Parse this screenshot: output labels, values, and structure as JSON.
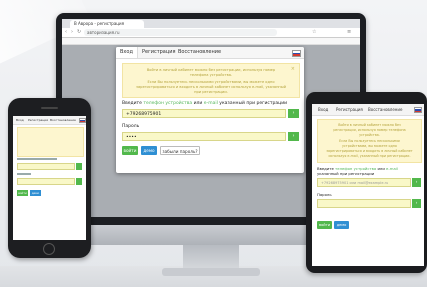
{
  "browser": {
    "tab_title": "В Аврора - регистрация",
    "url": "авторизация.ru"
  },
  "modal": {
    "tabs": [
      "Вход",
      "Регистрация",
      "Восстановление"
    ],
    "alert_lines": [
      "Войти в личный кабинет можно без регистрации, используя номер",
      "телефона устройства.",
      "Если Вы пользуетесь несколькими устройствами, вы можете одно",
      "зарегистрироваться и входить в личный кабинет используя e-mail, указанный",
      "при регистрации."
    ],
    "login_label_prefix": "Введите",
    "login_label_phone": "телефон устройства",
    "login_label_or": "или",
    "login_label_email": "e-mail",
    "login_label_suffix": "указанный при регистрации",
    "login_value": "+79268975901",
    "password_label": "Пароль",
    "password_value": "••••",
    "go_arrow": "›",
    "btn_login": "войти",
    "btn_demo": "демо",
    "btn_forgot": "забыли пароль?",
    "close_x": "×"
  },
  "tablet": {
    "tabs": [
      "Вход",
      "Регистрация",
      "Восстановление"
    ],
    "alert_lines": [
      "Войти в личный кабинет можно без",
      "регистрации, используя номер телефона",
      "устройства.",
      "Если Вы пользуетесь несколькими",
      "устройствами, вы можете одно",
      "зарегистрироваться и входить в личный кабинет",
      "используя e-mail, указанный при регистрации."
    ],
    "login_label_prefix": "Введите",
    "login_label_phone": "телефон устройства",
    "login_label_or": "или",
    "login_label_email": "e-mail",
    "login_label_suffix": "указанный при регистрации",
    "login_placeholder": "+79268975901 или mail@example.ru",
    "password_label": "Пароль",
    "btn_login": "войти",
    "btn_demo": "демо"
  },
  "phone": {
    "tabs": [
      "Вход",
      "Регистрация",
      "Восстановление"
    ],
    "btn_login": "войти",
    "btn_demo": "демо"
  },
  "colors": {
    "accent_green": "#52b84c",
    "accent_blue": "#2f8fd3",
    "alert_bg": "#fdf6cf",
    "input_bg": "#f9f8c8"
  }
}
